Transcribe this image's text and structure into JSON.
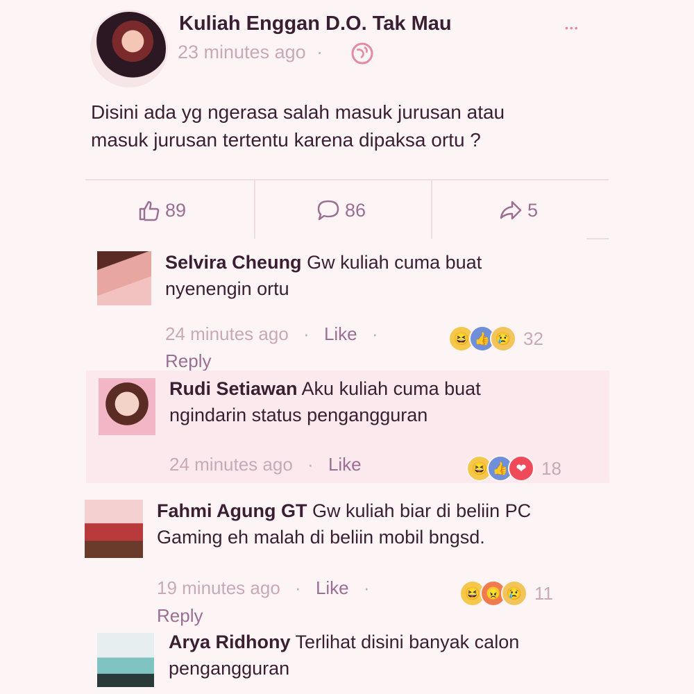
{
  "post": {
    "author": "Kuliah Enggan D.O. Tak Mau",
    "time": "23 minutes ago",
    "separator": "·",
    "text_line1": "Disini ada yg ngerasa salah masuk jurusan atau",
    "text_line2": "masuk jurusan tertentu karena dipaksa ortu ?",
    "likes": "89",
    "comments": "86",
    "shares": "5",
    "more_glyph": "•••"
  },
  "comments": [
    {
      "author": "Selvira Cheung",
      "line1": "Gw kuliah cuma buat",
      "line2": "nyenengin ortu",
      "time": "24 minutes ago",
      "like": "Like",
      "reply": "Reply",
      "reaction_count": "32"
    },
    {
      "author": "Rudi Setiawan",
      "line1": "Aku kuliah cuma buat",
      "line2": "ngindarin status pengangguran",
      "time": "24 minutes ago",
      "like": "Like",
      "reaction_count": "18"
    },
    {
      "author": "Fahmi Agung GT",
      "line1": "Gw kuliah biar di beliin PC",
      "line2": "Gaming eh malah di beliin mobil bngsd.",
      "time": "19 minutes ago",
      "like": "Like",
      "reply": "Reply",
      "reaction_count": "11"
    },
    {
      "author": "Arya Ridhony",
      "line1": "Terlihat disini banyak calon",
      "line2": "pengangguran"
    }
  ],
  "dot": "·",
  "colors": {
    "background": "#fdf4f5",
    "text": "#3a1f33",
    "muted": "#c9a9b8",
    "accent": "#9a6f93"
  }
}
